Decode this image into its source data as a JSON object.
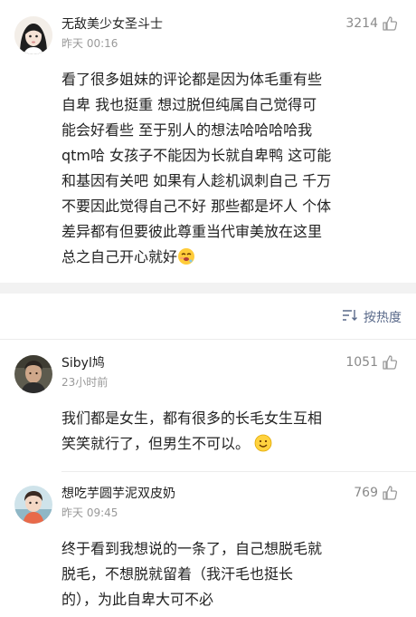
{
  "posts": [
    {
      "name": "无敌美少女圣斗士",
      "time": "昨天 00:16",
      "likes": "3214",
      "lines": [
        "看了很多姐妹的评论都是因为体毛重有些",
        "自卑  我也挺重  想过脱但纯属自己觉得可",
        "能会好看些  至于别人的想法哈哈哈哈我",
        "qtm哈  女孩子不能因为长就自卑鸭  这可能",
        "和基因有关吧  如果有人趁机讽刺自己  千万",
        "不要因此觉得自己不好  那些都是坏人  个体",
        "差异都有但要彼此尊重当代审美放在这里",
        "总之自己开心就好"
      ],
      "emoji": "drooling-face"
    }
  ],
  "sort": {
    "label": "按热度",
    "icon": "sort-icon"
  },
  "comments": [
    {
      "name": "Sibyl鸠",
      "time": "23小时前",
      "likes": "1051",
      "lines": [
        "我们都是女生，都有很多的长毛女生互相",
        "笑笑就行了，但男生不可以。"
      ],
      "emoji": "smile-face"
    },
    {
      "name": "想吃芋圆芋泥双皮奶",
      "time": "昨天 09:45",
      "likes": "769",
      "lines": [
        "终于看到我想说的一条了，自己想脱毛就",
        "脱毛，不想脱就留着（我汗毛也挺长",
        "的），为此自卑大可不必"
      ]
    }
  ],
  "colors": {
    "muted": "#999999",
    "link": "#5a6a8a",
    "divider": "#f2f2f2"
  }
}
